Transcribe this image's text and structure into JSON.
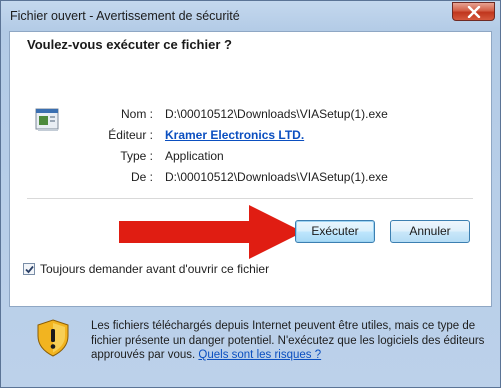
{
  "window": {
    "title": "Fichier ouvert - Avertissement de sécurité",
    "close_icon": "close-icon"
  },
  "dialog": {
    "question": "Voulez-vous exécuter ce fichier ?",
    "file_icon": "application-icon",
    "fields": {
      "name_label": "Nom :",
      "name_value": "D:\\00010512\\Downloads\\VIASetup(1).exe",
      "publisher_label": "Éditeur :",
      "publisher_value": "Kramer Electronics LTD.",
      "type_label": "Type :",
      "type_value": "Application",
      "from_label": "De :",
      "from_value": "D:\\00010512\\Downloads\\VIASetup(1).exe"
    },
    "buttons": {
      "run": "Exécuter",
      "cancel": "Annuler"
    },
    "checkbox": {
      "label": "Toujours demander avant d'ouvrir ce fichier",
      "checked": true
    },
    "warning": {
      "icon": "shield-warning-icon",
      "text": "Les fichiers téléchargés depuis Internet peuvent être utiles, mais ce type de fichier présente un danger potentiel. N'exécutez que les logiciels des éditeurs approuvés par vous.",
      "link": "Quels sont les risques ?"
    }
  },
  "colors": {
    "arrow": "#e01d12",
    "link": "#0b4fc0",
    "accent_border": "#3c7fb1"
  }
}
